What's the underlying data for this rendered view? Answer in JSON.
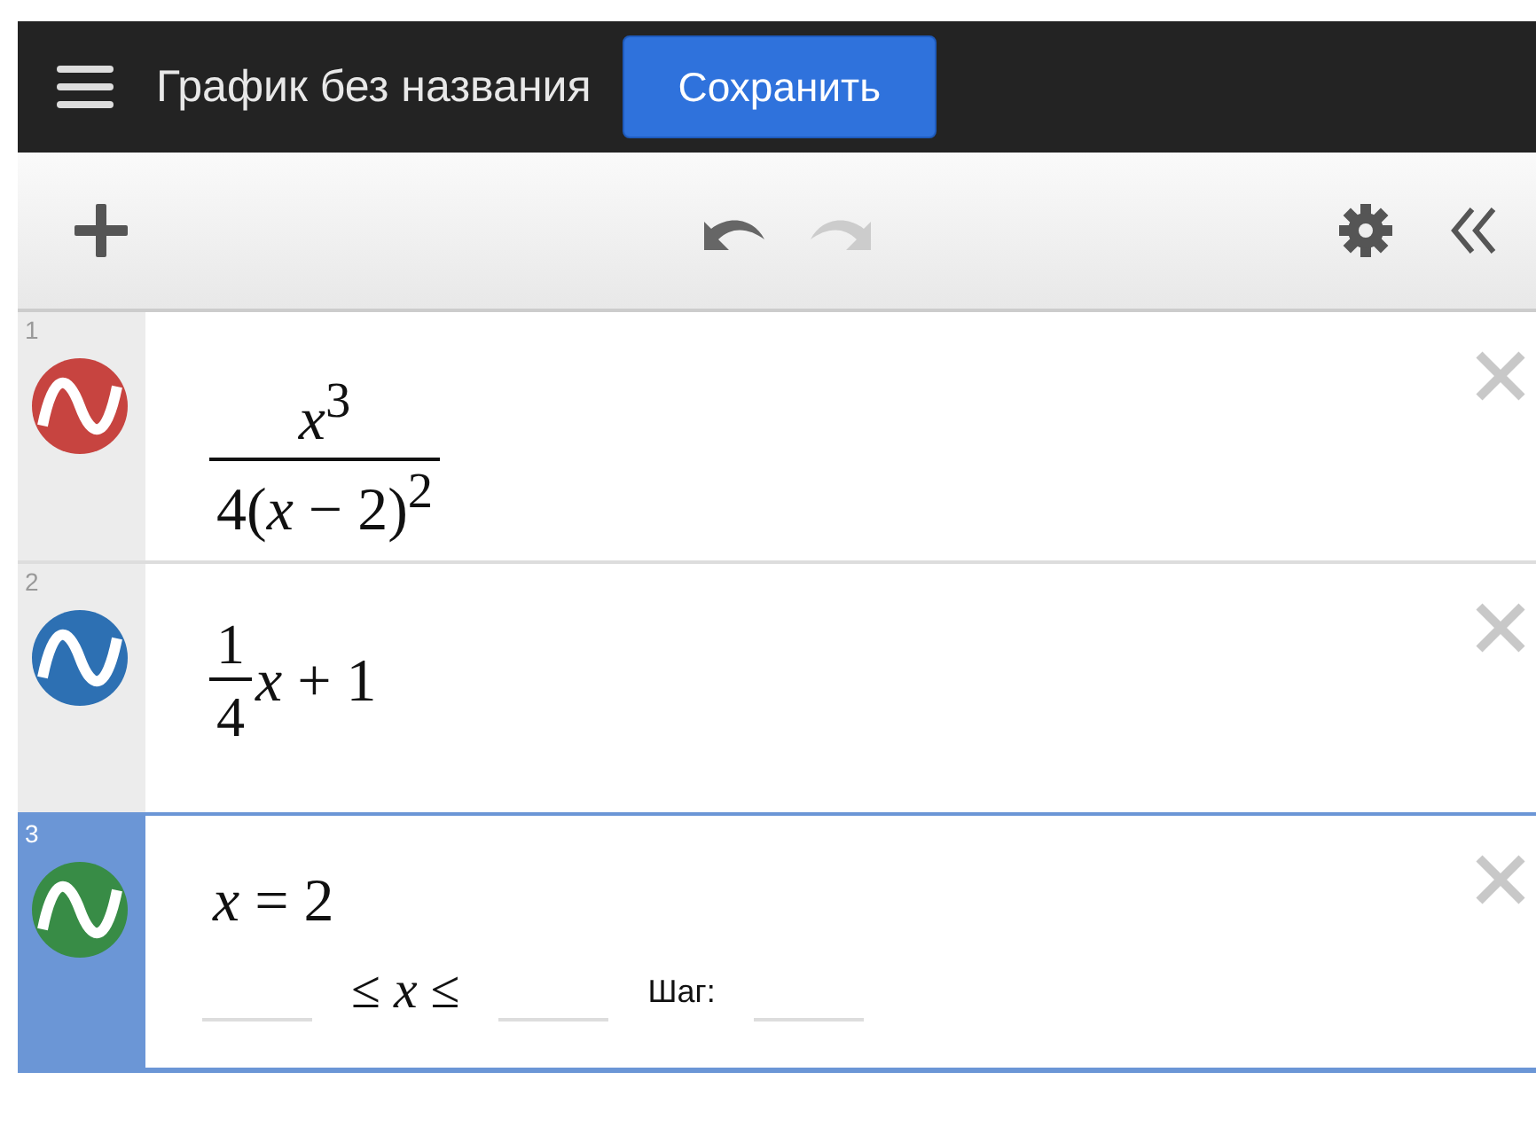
{
  "header": {
    "title": "График без названия",
    "save_button": "Сохранить"
  },
  "toolbar": {
    "undo_disabled": false,
    "redo_disabled": true
  },
  "expressions": [
    {
      "number": "1",
      "color": "#c74440",
      "selected": false,
      "kind": "fraction",
      "numerator": "*x*$^{3}$",
      "denominator": "4(*x* − 2)$^{2}$"
    },
    {
      "number": "2",
      "color": "#2d70b3",
      "selected": false,
      "kind": "fraction_term",
      "numerator": "1",
      "denominator": "4",
      "rest": "*x* + 1"
    },
    {
      "number": "3",
      "color": "#388c46",
      "selected": true,
      "kind": "plain",
      "text": "*x* = 2",
      "domain": {
        "relation": "≤ *x* ≤",
        "step_label": "Шаг:"
      }
    }
  ]
}
